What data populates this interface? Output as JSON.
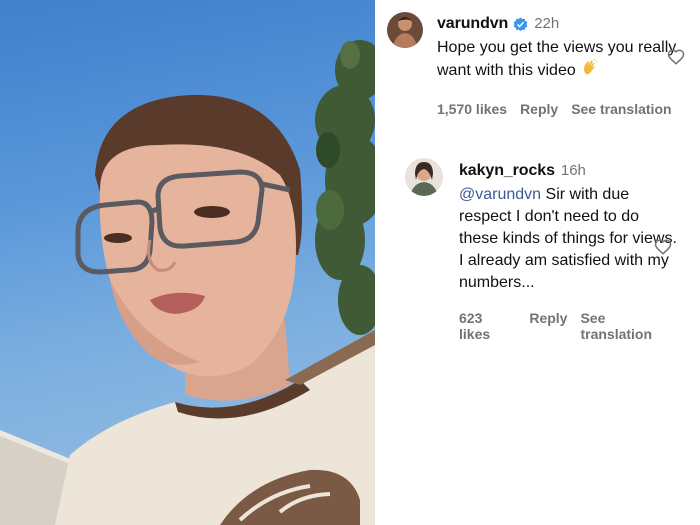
{
  "comments": [
    {
      "username": "varundvn",
      "verified": true,
      "time": "22h",
      "text": "Hope you get the views you really want with this video",
      "emoji": "clapping-hands-icon",
      "likes": "1,570 likes",
      "reply_label": "Reply",
      "translate_label": "See translation"
    },
    {
      "username": "kakyn_rocks",
      "verified": false,
      "time": "16h",
      "mention": "@varundvn",
      "text": "Sir with due respect I don't need to do these kinds of things for views. I already am satisfied with my numbers...",
      "likes": "623 likes",
      "reply_label": "Reply",
      "translate_label": "See translation"
    }
  ],
  "colors": {
    "verified_badge": "#3897f0",
    "mention": "#3d5a98",
    "meta_text": "#737373",
    "sky": "#5a97da"
  }
}
